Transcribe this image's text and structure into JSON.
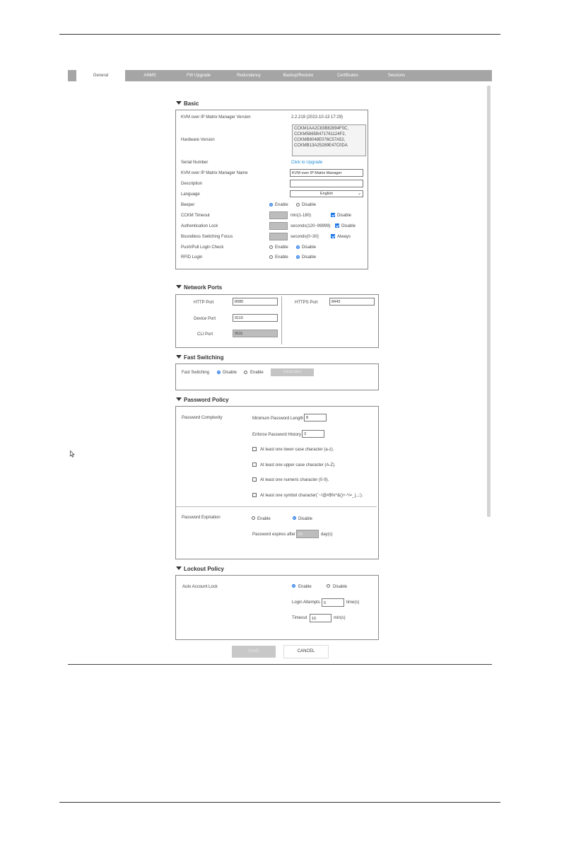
{
  "tabs": [
    "General",
    "ANMS",
    "FW Upgrade",
    "Redundancy",
    "Backup/Restore",
    "Certificates",
    "Sessions"
  ],
  "basic": {
    "title": "Basic",
    "version_label": "KVM over IP Matrix Manager Version",
    "version_value": "2.2.219 (2022-10-13 17:29)",
    "hw_label": "Hardware Version",
    "hw_lines": [
      "CCKM1AA2C83B82894F0C,",
      "CCKM5865B471761124F2,",
      "CCKMB8048E076C57A52,",
      "CCKMB13A25289E47C0DA"
    ],
    "serial_label": "Serial Number",
    "serial_link": "Click to Upgrade",
    "name_label": "KVM over IP Matrix Manager Name",
    "name_value": "KVM over IP Matrix Manager",
    "desc_label": "Description",
    "desc_value": "",
    "lang_label": "Language",
    "lang_value": "English",
    "beeper_label": "Beeper",
    "enable": "Enable",
    "disable": "Disable",
    "cckm_label": "CCKM Timeout",
    "cckm_unit": "min(1-180)",
    "auth_label": "Authentication Lock",
    "auth_unit": "seconds(120~99999)",
    "bsf_label": "Boundless Switching Focus",
    "bsf_unit": "seconds(0~30)",
    "always": "Always",
    "pushpull_label": "Push/Pull Login Check",
    "rfid_label": "RFID Login"
  },
  "network": {
    "title": "Network Ports",
    "http_label": "HTTP Port",
    "http_value": "8080",
    "https_label": "HTTPS Port",
    "https_value": "8443",
    "device_label": "Device Port",
    "device_value": "9110",
    "cli_label": "CLI Port",
    "cli_value": "9111"
  },
  "fast": {
    "title": "Fast Switching",
    "label": "Fast Switching",
    "disable": "Disable",
    "enable": "Enable",
    "button": "Initialization"
  },
  "password": {
    "title": "Password Policy",
    "complexity_label": "Password Complexity",
    "min_len_label": "Minimum Password Length",
    "min_len_value": "8",
    "history_label": "Enforce Password History",
    "history_value": "3",
    "rule_lower": "At least one lower case character (a-z).",
    "rule_upper": "At least one upper case character (A-Z).",
    "rule_numeric": "At least one numeric character (0-9).",
    "rule_symbol": "At least one symbol character(`~!@#$%^&()+-*/=_|,.;:).",
    "expiration_label": "Password Expiration",
    "enable": "Enable",
    "disable": "Disable",
    "expires_label": "Password expires after",
    "expires_value": "90",
    "expires_unit": "day(s)"
  },
  "lockout": {
    "title": "Lockout Policy",
    "auto_label": "Auto Account Lock",
    "enable": "Enable",
    "disable": "Disable",
    "attempts_label": "Login Attempts",
    "attempts_value": "5",
    "attempts_unit": "time(s)",
    "timeout_label": "Timeout",
    "timeout_value": "10",
    "timeout_unit": "min(s)"
  },
  "footer": {
    "save": "SAVE",
    "cancel": "CANCEL"
  }
}
